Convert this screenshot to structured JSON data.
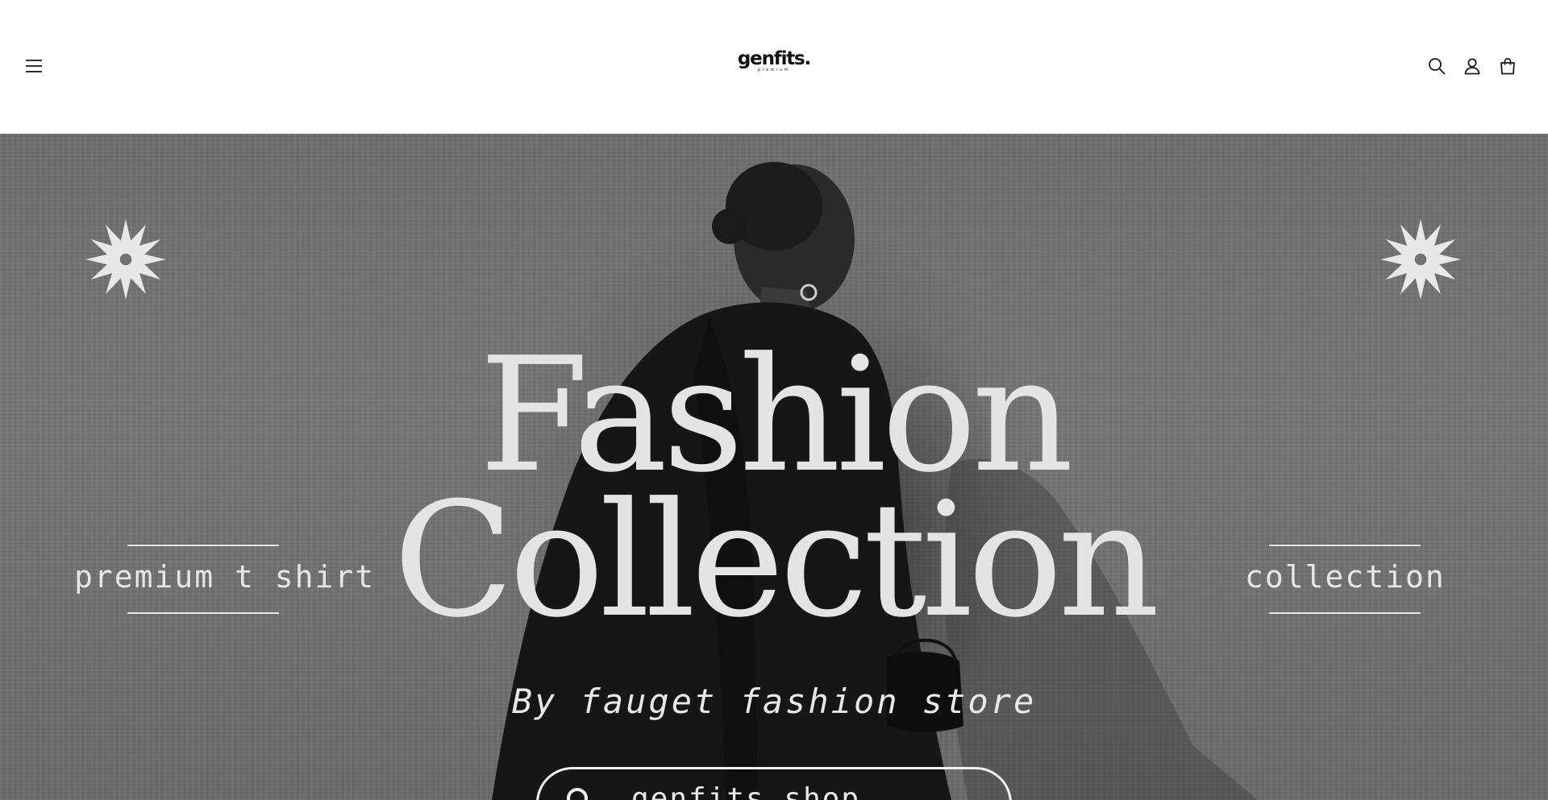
{
  "header": {
    "logo_text": "genfits.",
    "logo_subtext": "premium",
    "icons": [
      "hamburger-menu-icon",
      "search-icon",
      "account-icon",
      "cart-icon"
    ]
  },
  "hero": {
    "title_line1": "Fashion",
    "title_line2": "Collection",
    "left_label": "premium t shirt",
    "right_label": "collection",
    "subtitle": "By fauget fashion store",
    "search_text": "genfits shop",
    "decor_icons": [
      "sun-burst-icon",
      "sun-burst-icon"
    ]
  },
  "colors": {
    "header_bg": "#ffffff",
    "hero_bg": "#727272",
    "hero_text": "#e4e4e4",
    "icon": "#1a1a1a"
  }
}
